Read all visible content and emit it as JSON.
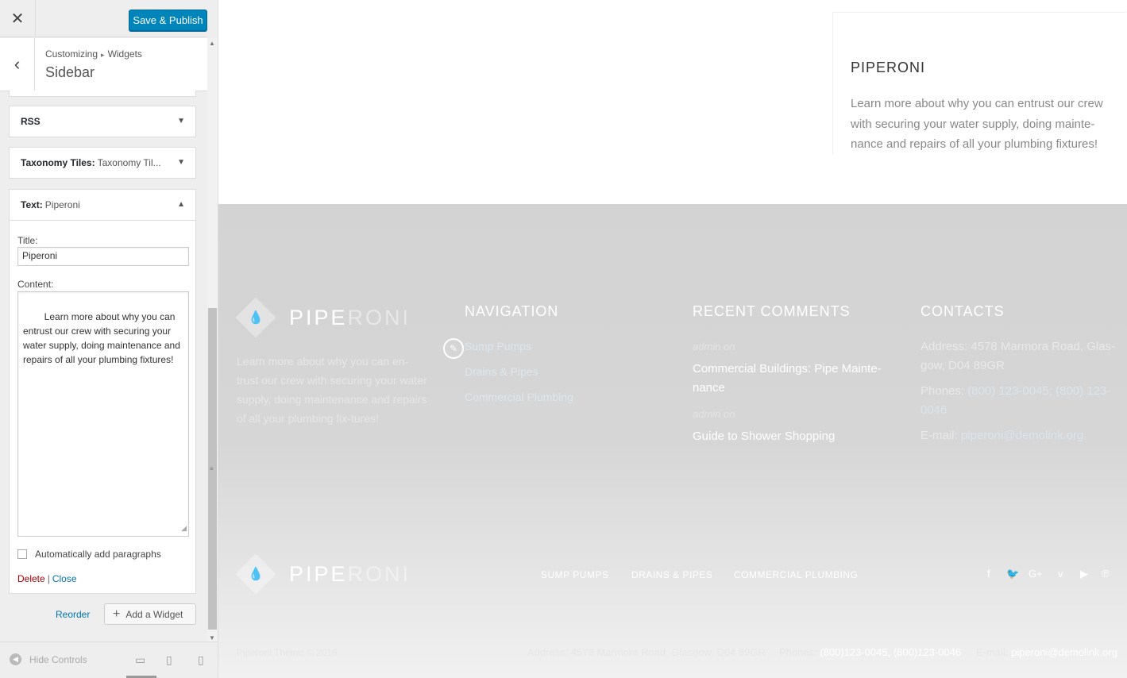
{
  "customizer": {
    "close_glyph": "✕",
    "publish_label": "Save & Publish",
    "back_glyph": "‹",
    "breadcrumb": {
      "root": "Customizing",
      "separator": "▸",
      "current": "Widgets"
    },
    "section_title": "Sidebar",
    "widgets": [
      {
        "name": "RSS",
        "subtitle": ""
      },
      {
        "name": "Taxonomy Tiles:",
        "subtitle": "Taxonomy Til..."
      },
      {
        "name": "Text:",
        "subtitle": "Piperoni"
      }
    ],
    "text_widget": {
      "title_label": "Title:",
      "title_value": "Piperoni",
      "content_label": "Content:",
      "content_value": "Learn more about why you can entrust our crew with securing your water supply, doing maintenance and repairs of all your plumbing fixtures!",
      "auto_paragraphs_label": "Automatically add paragraphs",
      "auto_paragraphs_checked": false,
      "delete_label": "Delete",
      "separator": "|",
      "close_label": "Close"
    },
    "reorder_label": "Reorder",
    "add_widget_label": "Add a Widget",
    "hide_controls_label": "Hide Controls",
    "active_device": "desktop"
  },
  "preview": {
    "sidebar_widget": {
      "title": "PIPERONI",
      "text": "Learn more about why you can entrust our crew with securing your water supply, doing mainte-nance and repairs of all your plumbing fixtures!"
    },
    "footer": {
      "logo": {
        "part1": "PIPE",
        "part2": "RONI"
      },
      "about_text": "Learn more about why you can en-trust our crew with securing your water supply, doing maintenance and repairs of all your plumbing fix-tures!",
      "navigation": {
        "heading": "NAVIGATION",
        "links": [
          "Sump Pumps",
          "Drains & Pipes",
          "Commercial Plumbing"
        ]
      },
      "recent_comments": {
        "heading": "RECENT COMMENTS",
        "items": [
          {
            "meta": "admin  on",
            "title": "Commercial Buildings: Pipe Mainte-nance"
          },
          {
            "meta": "admin  on",
            "title": "Guide to Shower Shopping"
          }
        ]
      },
      "contacts": {
        "heading": "CONTACTS",
        "address": "Address: 4578 Marmora Road, Glas-gow, D04 89GR",
        "phones_label": "Phones:",
        "phones_value": "(800) 123-0045; (800) 123-0046",
        "email_label": "E-mail:",
        "email_value": "piperoni@demolink.org"
      },
      "bottom_nav": [
        "SUMP PUMPS",
        "DRAINS & PIPES",
        "COMMERCIAL PLUMBING"
      ],
      "social": [
        "facebook-icon",
        "twitter-icon",
        "google-plus-icon",
        "vimeo-icon",
        "youtube-icon",
        "pinterest-icon"
      ],
      "copyright": "Piperoni Theme © 2016",
      "bottom_address": "Address: 4578 Marmora Road, Glasgow, D04 89GR",
      "bottom_phones_label": "Phones:",
      "bottom_phones_value": "(800)123-0045, (800)123-0046",
      "bottom_email_label": "E-mail:",
      "bottom_email_value": "piperoni@demolink.org"
    }
  },
  "colors": {
    "publish": "#0085ba",
    "link": "#0073aa",
    "delete": "#aa0000",
    "footer_bg": "#d3d3d3"
  }
}
